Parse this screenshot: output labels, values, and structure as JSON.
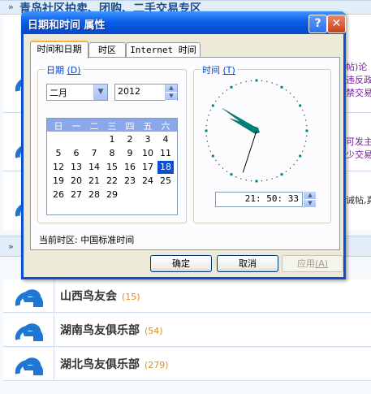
{
  "background": {
    "section1_title": "青岛社区拍卖、团购、二手交易专区",
    "section1_arrow": "»",
    "snip1": "帖)论",
    "snip2": "违反政",
    "snip3": "禁交易",
    "snip4": "可发主",
    "snip5": "少交易",
    "snip6": "诫帖,真",
    "section2_arrow": "»",
    "forums": [
      {
        "name": "山西鸟友会",
        "count": "(15)"
      },
      {
        "name": "湖南鸟友俱乐部",
        "count": "(54)"
      },
      {
        "name": "湖北鸟友俱乐部",
        "count": "(279)"
      }
    ]
  },
  "dialog": {
    "title": "日期和时间 属性",
    "help_label": "?",
    "close_label": "✕",
    "tabs": [
      "时间和日期",
      "时区",
      "Internet 时间"
    ],
    "date_group": {
      "label": "日期",
      "accel": "(D)"
    },
    "month": "二月",
    "year": "2012",
    "weekdays": [
      "日",
      "一",
      "二",
      "三",
      "四",
      "五",
      "六"
    ],
    "days": [
      [
        "",
        "",
        "",
        "1",
        "2",
        "3",
        "4"
      ],
      [
        "5",
        "6",
        "7",
        "8",
        "9",
        "10",
        "11"
      ],
      [
        "12",
        "13",
        "14",
        "15",
        "16",
        "17",
        "18"
      ],
      [
        "19",
        "20",
        "21",
        "22",
        "23",
        "24",
        "25"
      ],
      [
        "26",
        "27",
        "28",
        "29",
        "",
        "",
        ""
      ]
    ],
    "selected_day": "18",
    "time_group": {
      "label": "时间",
      "accel": "(T)"
    },
    "time": "21: 50: 33",
    "clock": {
      "hour": 21,
      "minute": 50,
      "second": 33
    },
    "timezone_text": "当前时区: 中国标准时间",
    "buttons": {
      "ok": "确定",
      "cancel": "取消",
      "apply": "应用",
      "apply_accel": "(A)"
    }
  },
  "colors": {
    "accent": "#0a4fd6",
    "hands": "#00857a",
    "title_link": "#1d4e93",
    "count": "#e38d13"
  }
}
